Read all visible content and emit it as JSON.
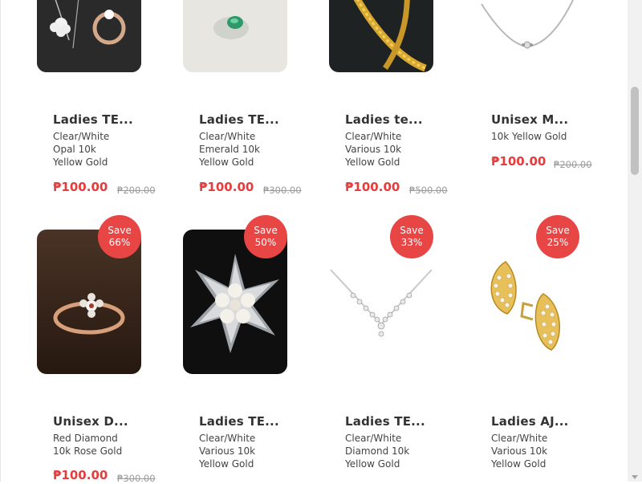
{
  "products": [
    {
      "name": "Ladies TE...",
      "desc": [
        "Clear/White",
        "Opal 10k",
        "Yellow Gold"
      ],
      "price": "₱100.00",
      "old_price": "₱200.00",
      "save": null,
      "image": "ring-and-earrings-photo"
    },
    {
      "name": "Ladies TE...",
      "desc": [
        "Clear/White",
        "Emerald 10k",
        "Yellow Gold"
      ],
      "price": "₱100.00",
      "old_price": "₱300.00",
      "save": null,
      "image": "emerald-ring-photo"
    },
    {
      "name": "Ladies te...",
      "desc": [
        "Clear/White",
        "Various 10k",
        "Yellow Gold"
      ],
      "price": "₱100.00",
      "old_price": "₱500.00",
      "save": null,
      "image": "gold-chain-photo"
    },
    {
      "name": "Unisex M...",
      "desc": [
        "10k Yellow Gold"
      ],
      "price": "₱100.00",
      "old_price": "₱200.00",
      "save": null,
      "image": "silver-bracelet-photo"
    },
    {
      "name": "Unisex D...",
      "desc": [
        "Red Diamond",
        "10k Rose Gold"
      ],
      "price": "₱100.00",
      "old_price": "₱300.00",
      "save": {
        "line1": "Save",
        "line2": "66%"
      },
      "image": "rose-gold-ring-photo"
    },
    {
      "name": "Ladies TE...",
      "desc": [
        "Clear/White",
        "Various 10k",
        "Yellow Gold"
      ],
      "price": "",
      "old_price": "",
      "save": {
        "line1": "Save",
        "line2": "50%"
      },
      "image": "pearl-brooch-photo"
    },
    {
      "name": "Ladies TE...",
      "desc": [
        "Clear/White",
        "Diamond 10k",
        "Yellow Gold"
      ],
      "price": "",
      "old_price": "",
      "save": {
        "line1": "Save",
        "line2": "33%"
      },
      "image": "diamond-necklace-photo"
    },
    {
      "name": "Ladies AJ...",
      "desc": [
        "Clear/White",
        "Various 10k",
        "Yellow Gold"
      ],
      "price": "",
      "old_price": "",
      "save": {
        "line1": "Save",
        "line2": "25%"
      },
      "image": "gold-earrings-photo"
    }
  ],
  "colors": {
    "accent": "#e84545",
    "price": "#e43d3d"
  }
}
